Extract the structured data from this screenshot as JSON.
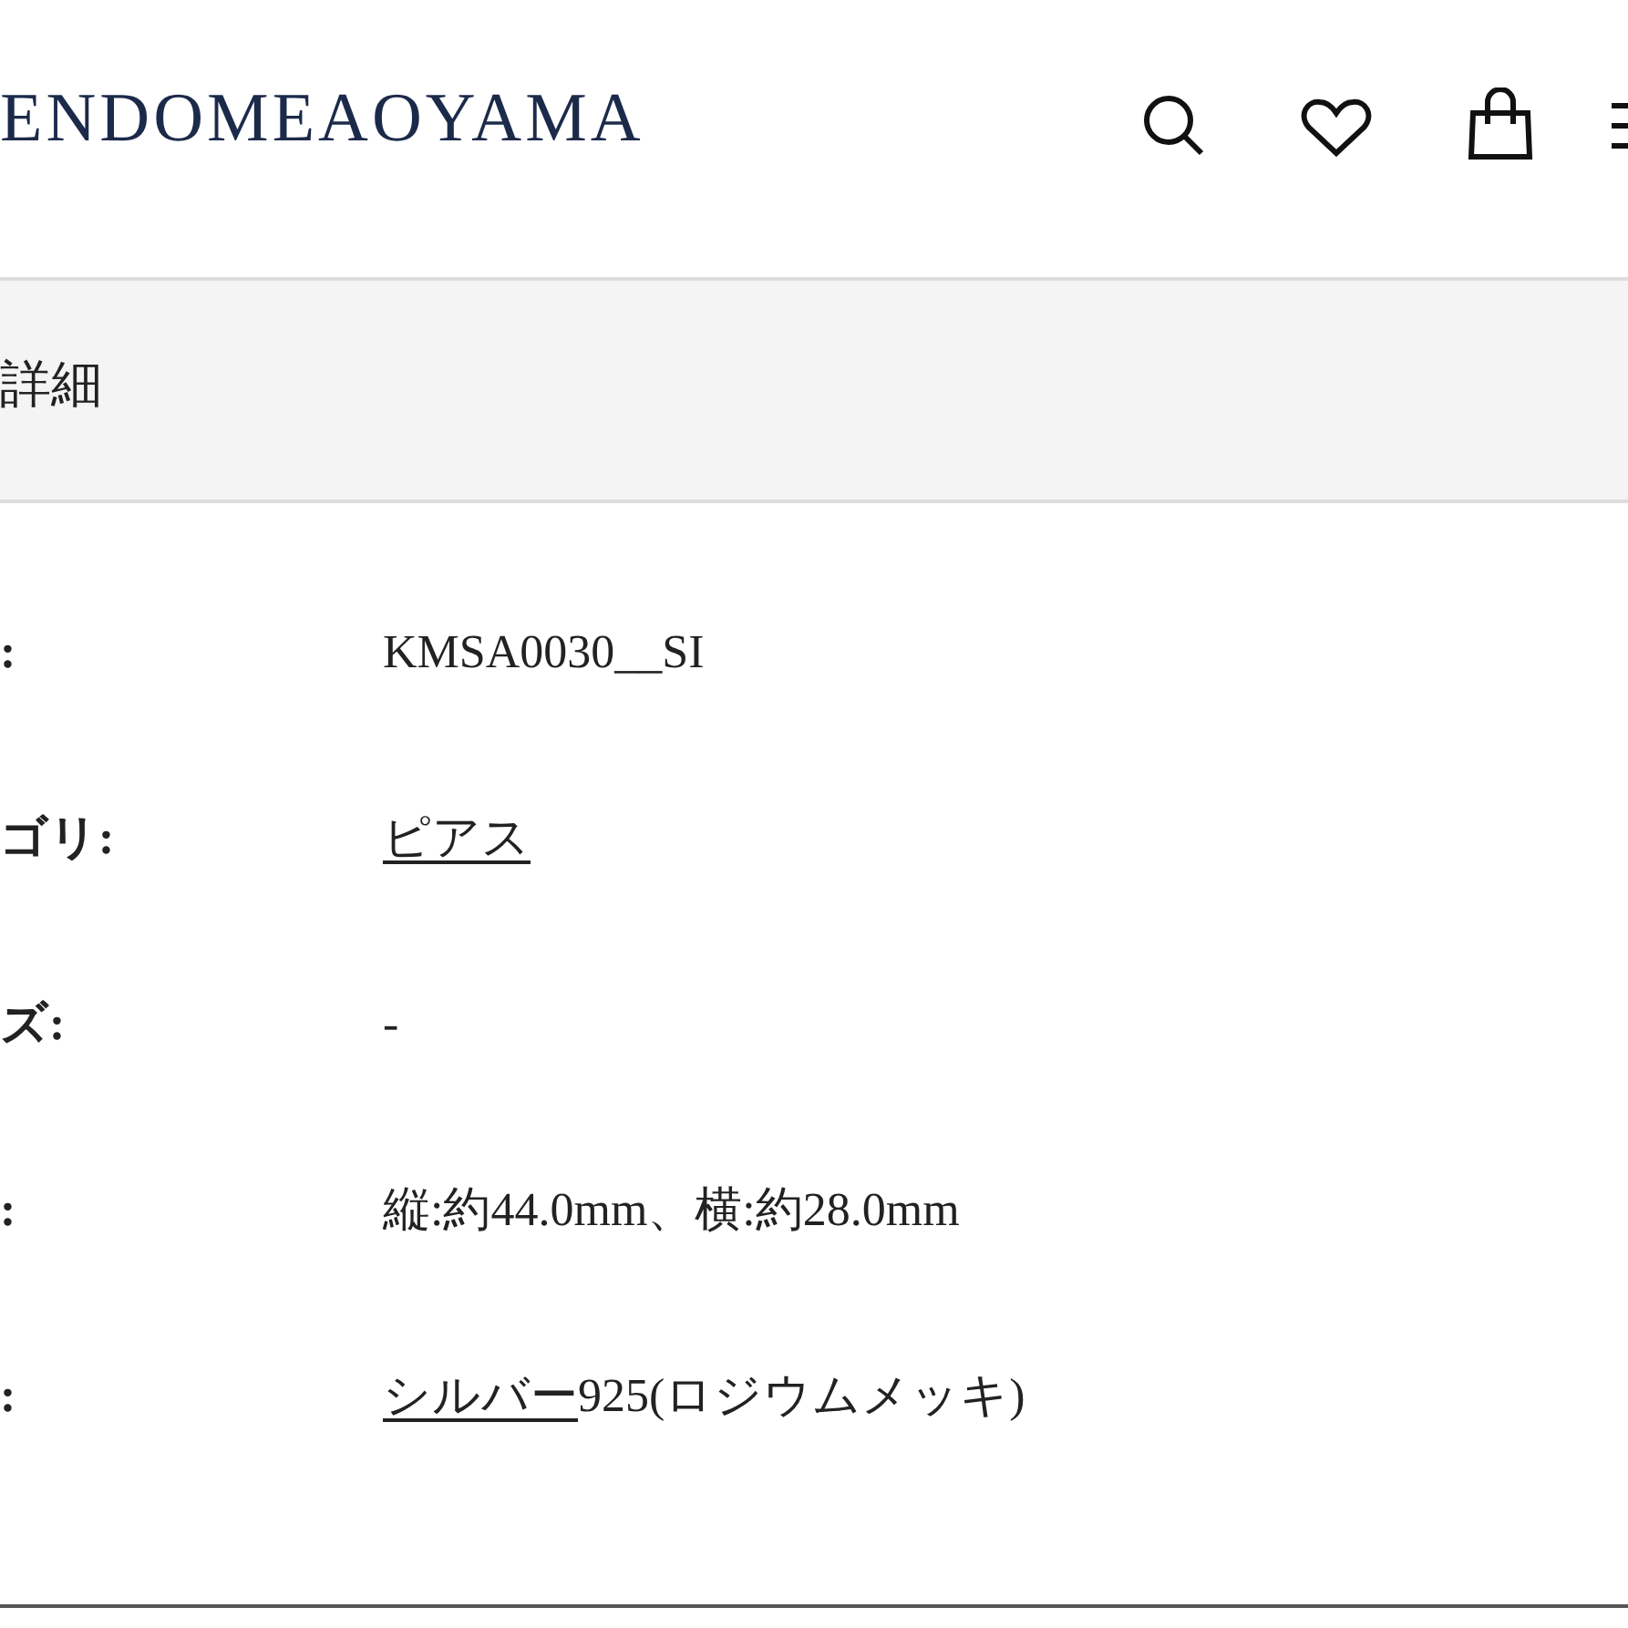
{
  "header": {
    "logo": "ENDOMEAOYAMA"
  },
  "section": {
    "title": "詳細"
  },
  "rows": [
    {
      "label": ":",
      "value": "KMSA0030__SI"
    },
    {
      "label": "ゴリ:",
      "link": "ピアス"
    },
    {
      "label": "ズ:",
      "value": "-"
    },
    {
      "label": ":",
      "value": "縦:約44.0mm、横:約28.0mm"
    },
    {
      "label": ":",
      "link": "シルバー",
      "value": "925(ロジウムメッキ)"
    }
  ]
}
